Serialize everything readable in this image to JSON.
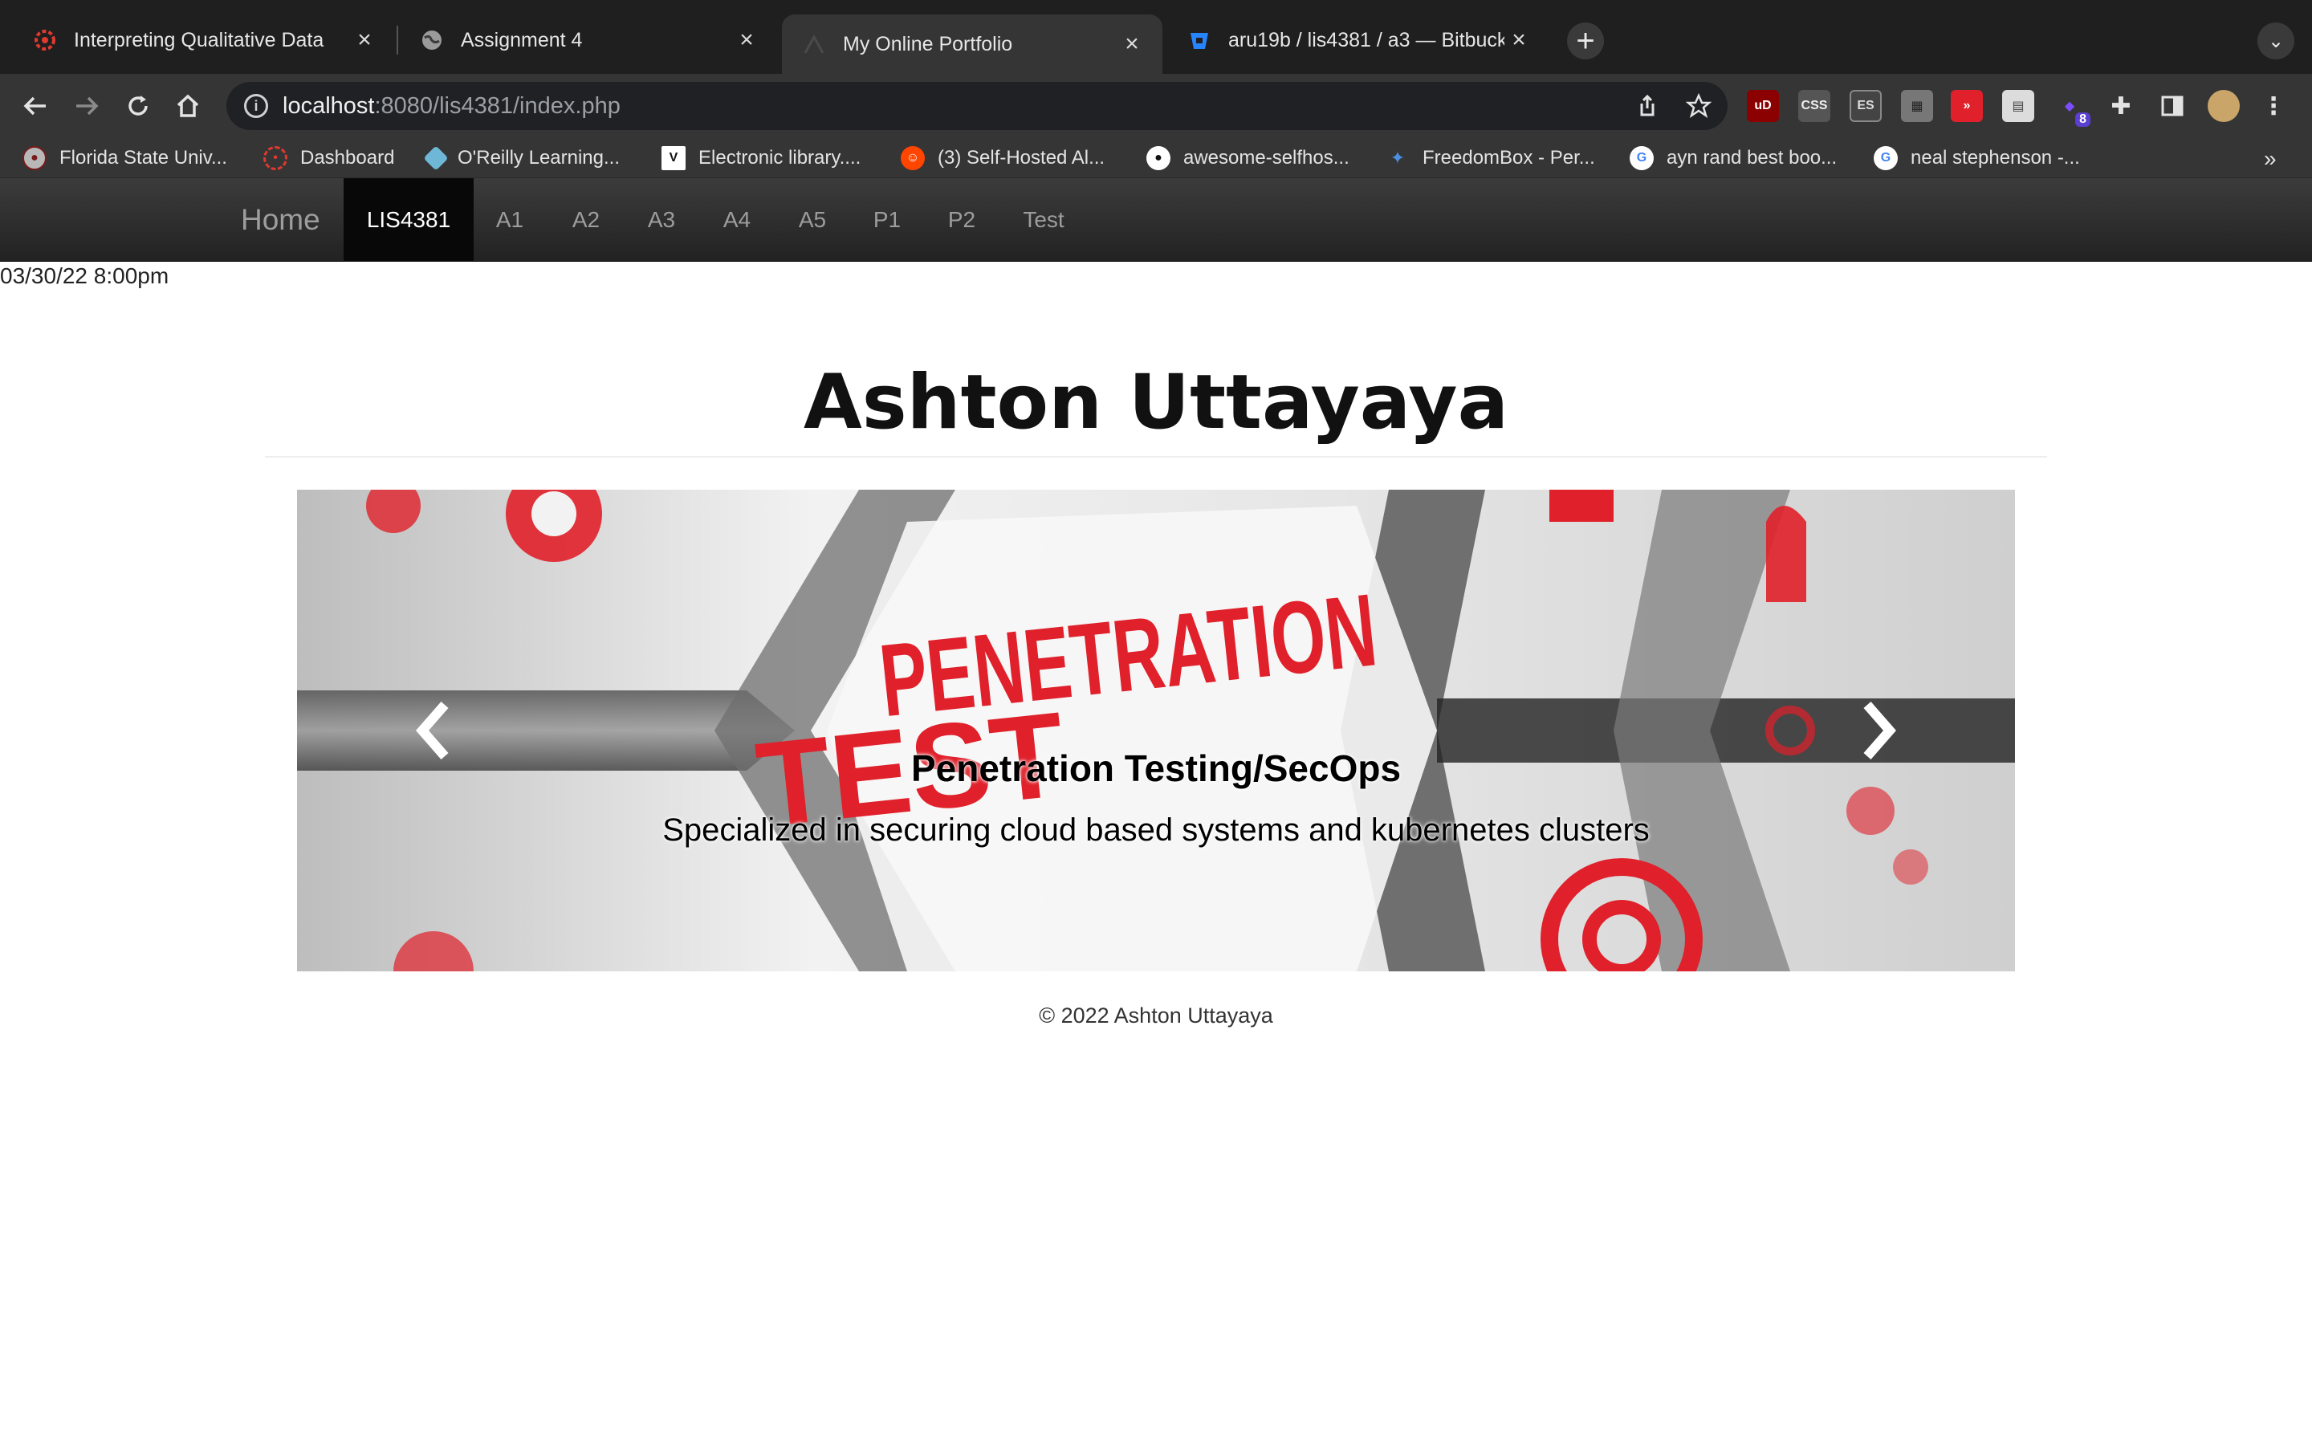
{
  "browser": {
    "tabs": [
      {
        "title": "Interpreting Qualitative Data",
        "icon": "canvas-icon"
      },
      {
        "title": "Assignment 4",
        "icon": "globe-icon"
      },
      {
        "title": "My Online Portfolio",
        "icon": "page-icon",
        "active": true
      },
      {
        "title": "aru19b / lis4381 / a3 — Bitbuck",
        "icon": "bitbucket-icon"
      }
    ],
    "new_tab": "+",
    "tab_menu": "⌄",
    "url_host": "localhost",
    "url_path": ":8080/lis4381/index.php",
    "extension_badge": "8",
    "bookmarks": [
      {
        "label": "Florida State Univ...",
        "icon": "fsu-seal-icon"
      },
      {
        "label": "Dashboard",
        "icon": "canvas-icon"
      },
      {
        "label": "O'Reilly Learning...",
        "icon": "oreilly-icon"
      },
      {
        "label": "Electronic library....",
        "icon": "vlib-icon"
      },
      {
        "label": "(3) Self-Hosted Al...",
        "icon": "reddit-icon"
      },
      {
        "label": "awesome-selfhos...",
        "icon": "github-icon"
      },
      {
        "label": "FreedomBox - Per...",
        "icon": "bluesky-icon"
      },
      {
        "label": "ayn rand best boo...",
        "icon": "google-icon"
      },
      {
        "label": "neal stephenson -...",
        "icon": "google-icon"
      }
    ],
    "bookmarks_more": "»",
    "colors": {
      "chrome_dark": "#1f1f1f",
      "chrome_toolbar": "#353535",
      "omnibox": "#202124"
    }
  },
  "navbar": {
    "brand": "Home",
    "items": [
      "LIS4381",
      "A1",
      "A2",
      "A3",
      "A4",
      "A5",
      "P1",
      "P2",
      "Test"
    ],
    "active_item": "LIS4381",
    "colors": {
      "bg": "#222222",
      "active_bg": "#080808",
      "text": "#9d9d9d"
    }
  },
  "datetime": "03/30/22 8:00pm",
  "header": {
    "title": "Ashton Uttayaya"
  },
  "carousel": {
    "image_text_line1": "PENETRATION",
    "image_text_line2": "TEST",
    "caption_title": "Penetration Testing/SecOps",
    "caption_text": "Specialized in securing cloud based systems and kubernetes clusters",
    "prev": "‹",
    "next": "›",
    "accent_color": "#e0202a"
  },
  "footer": {
    "text": "© 2022 Ashton Uttayaya"
  }
}
